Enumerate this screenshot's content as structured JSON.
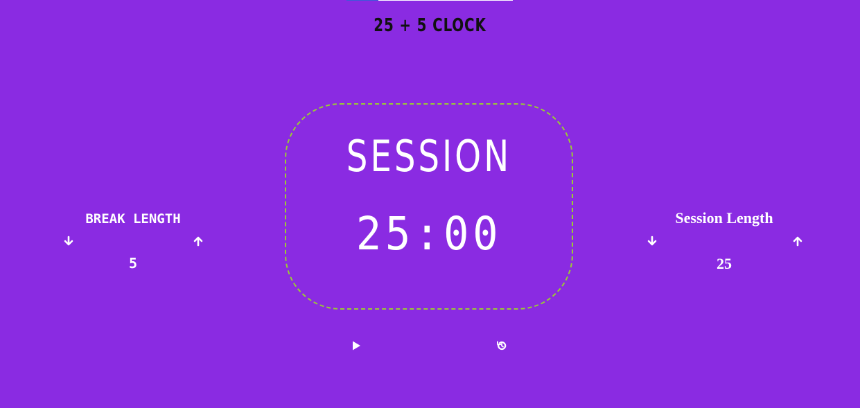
{
  "app": {
    "title": "25 + 5 CLOCK"
  },
  "timer": {
    "label": "SESSION",
    "display": "25:00"
  },
  "break_control": {
    "title": "BREAK LENGTH",
    "value": "5",
    "decrement_icon": "arrow-down-icon",
    "increment_icon": "arrow-up-icon"
  },
  "session_control": {
    "title": "Session Length",
    "value": "25",
    "decrement_icon": "arrow-down-icon",
    "increment_icon": "arrow-up-icon"
  },
  "controls": {
    "start_stop_icon": "play-icon",
    "reset_icon": "reset-history-icon"
  },
  "colors": {
    "background": "#8a2be2",
    "timer_border": "#9acd32",
    "text": "#ffffff",
    "title_text": "#111111"
  }
}
